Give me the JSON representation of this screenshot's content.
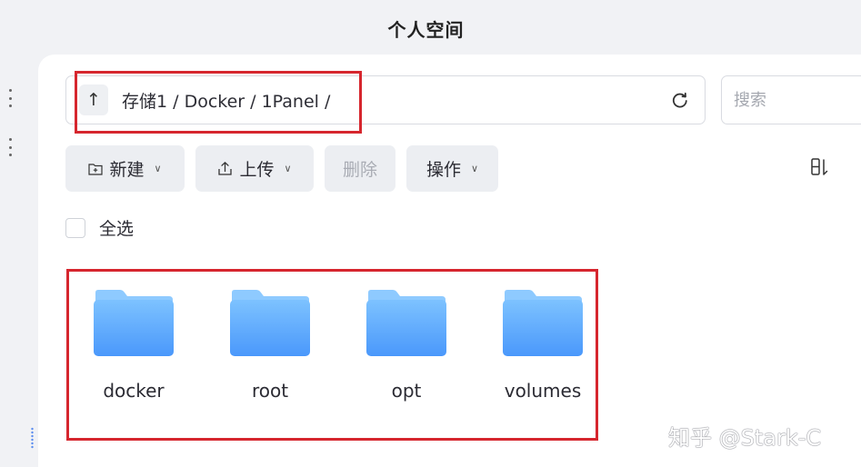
{
  "header": {
    "title": "个人空间"
  },
  "pathbar": {
    "path": "存储1 / Docker / 1Panel /"
  },
  "search": {
    "placeholder": "搜索"
  },
  "toolbar": {
    "new_label": "新建",
    "upload_label": "上传",
    "delete_label": "删除",
    "ops_label": "操作"
  },
  "select_all_label": "全选",
  "folders": [
    {
      "name": "docker"
    },
    {
      "name": "root"
    },
    {
      "name": "opt"
    },
    {
      "name": "volumes"
    }
  ],
  "watermark": "知乎 @Stark-C",
  "colors": {
    "annotation": "#d6262e",
    "folder_front": "#5aa8ff",
    "folder_back": "#8cc6ff"
  }
}
